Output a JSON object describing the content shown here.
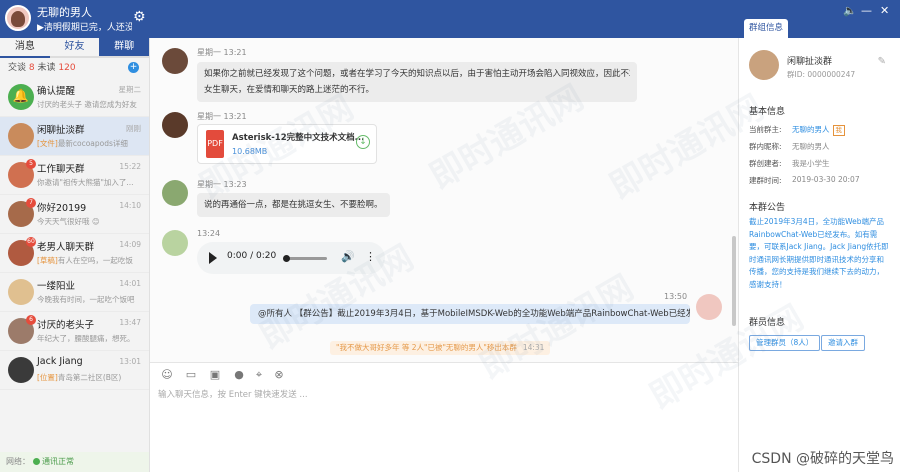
{
  "user": {
    "name": "无聊的男人",
    "signature": "▶清明假期已完，人还没有..."
  },
  "left_tabs": [
    "消息",
    "好友",
    "群聊"
  ],
  "counts": {
    "sessions_label": "交谈",
    "sessions": "8",
    "unread_label": "未读",
    "unread": "120"
  },
  "conversations": [
    {
      "name": "确认提醒",
      "time": "星期二",
      "preview": "讨厌的老头子 邀请您成为好友",
      "badge": "",
      "color": "#4caf50"
    },
    {
      "name": "闲聊扯淡群",
      "time": "刚刚",
      "preview_tag": "[文件]",
      "preview": "最新cocoapods详细",
      "badge": "",
      "color": "#c98b5c"
    },
    {
      "name": "工作聊天群",
      "time": "15:22",
      "preview": "你邀请\"祖传大熊猫\"加入了...",
      "badge": "5",
      "color": "#d07050"
    },
    {
      "name": "你好20199",
      "time": "14:10",
      "preview": "今天天气很好哦 😊",
      "badge": "7",
      "color": "#a66a4a"
    },
    {
      "name": "老男人聊天群",
      "time": "14:09",
      "preview_tag": "[草稿]",
      "preview": "有人在空吗，一起吃饭",
      "badge": "60",
      "color": "#b05a40"
    },
    {
      "name": "一缕阳业",
      "time": "14:01",
      "preview": "今晚我有时间，一起吃个饭吧",
      "badge": "",
      "color": "#e0c090"
    },
    {
      "name": "讨厌的老头子",
      "time": "13:47",
      "preview": "年纪大了，腰酸腿痛，想死。",
      "badge": "6",
      "color": "#9c7b6a"
    },
    {
      "name": "Jack Jiang",
      "time": "13:01",
      "preview_tag": "[位置]",
      "preview": "青岛第二社区(B区)",
      "badge": "",
      "color": "#3a3a3a"
    }
  ],
  "network": {
    "label": "网络：",
    "status": "通讯正常"
  },
  "messages": {
    "m1": {
      "sender": "星期一 13:21",
      "text1": "如果你之前就已经发现了这个问题，或者在学习了今天的知识点以后，由于害怕主动开场会陷入同视效应，因此不敢和",
      "text2": "女生聊天，在爱情和聊天的路上迷茫的不行。"
    },
    "m2": {
      "sender": "星期一 13:21",
      "file_name": "Asterisk-12完整中文技术文档...",
      "file_size": "10.68MB",
      "file_icon": "pdf-icon"
    },
    "m3": {
      "sender": "星期一 13:23",
      "text": "说的再通俗一点，都是在挑逗女生、不要脸啊。"
    },
    "m4": {
      "sender": "13:24",
      "audio_time": "0:00 / 0:20"
    },
    "m5": {
      "time": "13:50",
      "text": "@所有人 【群公告】截止2019年3月4日，基于MobileIMSDK-Web的全功能Web端产品RainbowChat-Web已经发布。"
    },
    "notice": {
      "text": "\"我不做大哥好多年 等 2人\"已被\"无聊的男人\"移出本群",
      "time": "14:31"
    }
  },
  "input_placeholder": "输入聊天信息，按 Enter 键快速发送 ...",
  "right": {
    "tab": "群组信息",
    "group_name": "闲聊扯淡群",
    "group_id": "群ID: 0000000247",
    "basic_title": "基本信息",
    "owner_k": "当前群主:",
    "owner_v": "无聊的男人",
    "owner_tag": "我",
    "nick_k": "群内昵称:",
    "nick_v": "无聊的男人",
    "creator_k": "群创建者:",
    "creator_v": "我是小学生",
    "created_k": "建群时间:",
    "created_v": "2019-03-30 20:07",
    "ann_title": "本群公告",
    "ann_text": "截止2019年3月4日，全功能Web端产品RainbowChat-Web已经发布。如有需要，可联系Jack Jiang。Jack Jiang依托即时通讯网长期提供即时通讯技术的分享和传播，您的支持是我们继续下去的动力，感谢支持！",
    "members_title": "群员信息",
    "manage_btn": "管理群员（8人）",
    "invite_btn": "邀请入群"
  },
  "watermark": "即时通讯网",
  "credit": "CSDN @破碎的天堂鸟"
}
